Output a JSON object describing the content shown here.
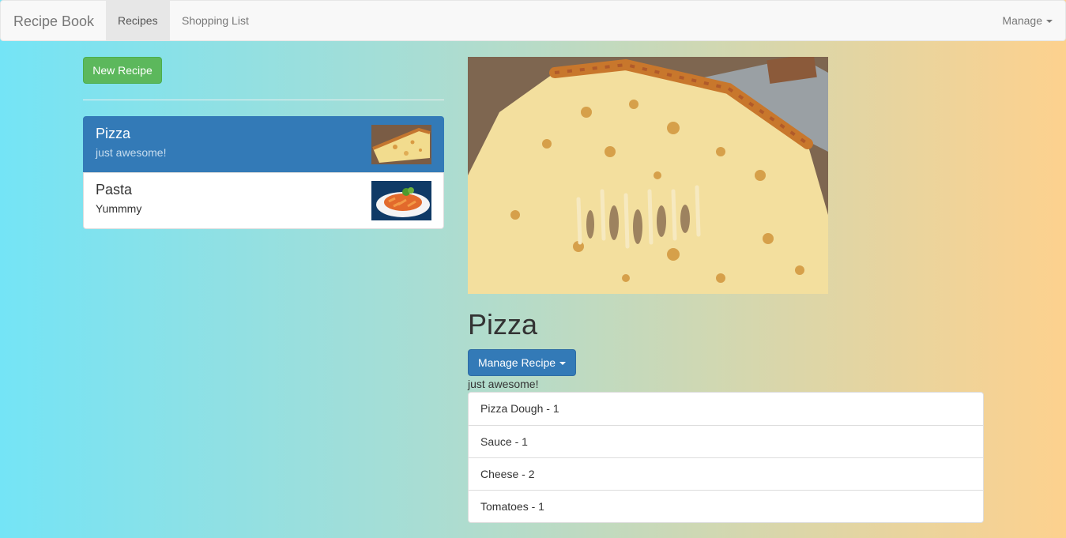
{
  "navbar": {
    "brand": "Recipe Book",
    "tabs": [
      {
        "label": "Recipes",
        "active": true
      },
      {
        "label": "Shopping List",
        "active": false
      }
    ],
    "manage_label": "Manage"
  },
  "sidebar": {
    "new_button": "New Recipe",
    "recipes": [
      {
        "name": "Pizza",
        "description": "just awesome!",
        "active": true
      },
      {
        "name": "Pasta",
        "description": "Yummmy",
        "active": false
      }
    ]
  },
  "detail": {
    "title": "Pizza",
    "manage_button": "Manage Recipe",
    "description": "just awesome!",
    "ingredients": [
      "Pizza Dough - 1",
      "Sauce - 1",
      "Cheese - 2",
      "Tomatoes - 1"
    ]
  },
  "colors": {
    "primary": "#337ab7",
    "success": "#5cb85c",
    "gradient_start": "#74e4f6",
    "gradient_end": "#fdd18e"
  }
}
